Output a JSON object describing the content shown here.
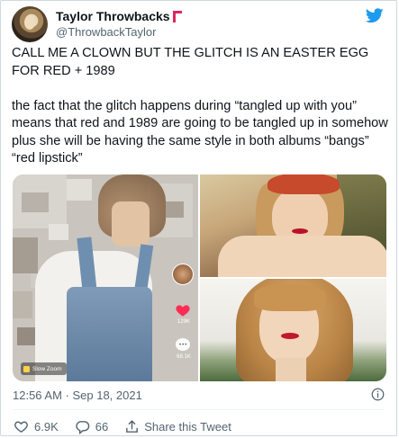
{
  "author": {
    "display_name": "Taylor Throwbacks",
    "handle": "@ThrowbackTaylor"
  },
  "tweet": {
    "text": "CALL ME A CLOWN BUT THE GLITCH IS AN EASTER EGG FOR RED + 1989\n\nthe fact that the glitch happens during “tangled up with you” means that red and 1989 are going to be tangled up in somehow plus she will be having the same style in both albums “bangs” “red lipstick”"
  },
  "media": {
    "left_video": {
      "heart_count": "129K",
      "comment_count": "68.1K",
      "effect_label": "Slow Zoom"
    }
  },
  "meta": {
    "timestamp": "12:56 AM · Sep 18, 2021"
  },
  "actions": {
    "like_count": "6.9K",
    "reply_count": "66",
    "share_label": "Share this Tweet"
  },
  "colors": {
    "twitter_blue": "#1d9bf0",
    "secondary_text": "#536471",
    "badge_red": "#e0245e"
  },
  "icons": [
    "twitter-bird-icon",
    "info-icon",
    "heart-icon",
    "reply-icon",
    "share-icon"
  ]
}
